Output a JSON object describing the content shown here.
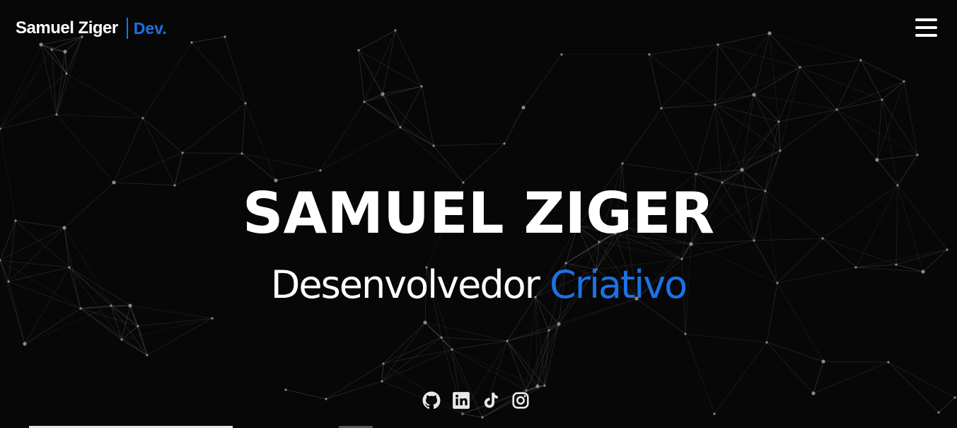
{
  "header": {
    "brand_name": "Samuel Ziger",
    "brand_suffix": "Dev.",
    "menu_icon": "hamburger-menu-icon"
  },
  "hero": {
    "title": "SAMUEL ZIGER",
    "subtitle_main": "Desenvolvedor",
    "subtitle_accent": "Criativo"
  },
  "socials": [
    {
      "icon": "github-icon"
    },
    {
      "icon": "linkedin-icon"
    },
    {
      "icon": "tiktok-icon"
    },
    {
      "icon": "instagram-icon"
    }
  ],
  "colors": {
    "background": "#070707",
    "accent": "#1a73e8",
    "text": "#ffffff",
    "network_lines": "#5a5a5a",
    "network_nodes": "#8a8a8a"
  }
}
